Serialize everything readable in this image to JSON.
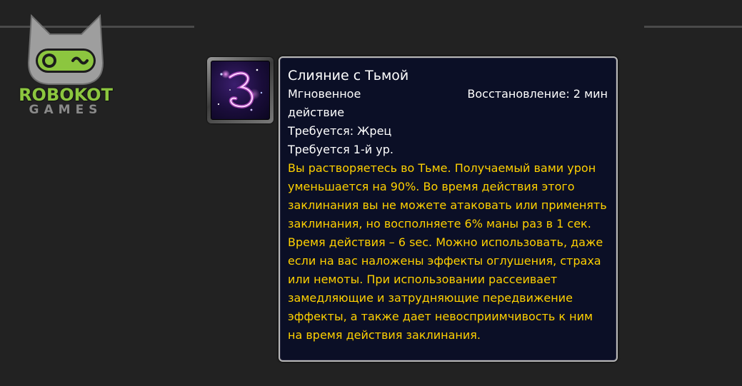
{
  "logo": {
    "word1": "ROBOKOT",
    "word2": "GAMES",
    "colors": {
      "green": "#8cc63f",
      "gray": "#8a8a8a",
      "head": "#9e9e9e"
    },
    "icon": "robot-cat-head-icon"
  },
  "spell": {
    "icon": "shadow-swirl-icon",
    "title": "Слияние с Тьмой",
    "cast_type": "Мгновенное действие",
    "cooldown": "Восстановление: 2 мин",
    "requires_class": "Требуется: Жрец",
    "requires_level": "Требуется 1-й ур.",
    "description": "Вы растворяетесь во Тьме. Получаемый вами урон уменьшается на 90%. Во время действия этого заклинания вы не можете атаковать или применять заклинания, но восполняете 6% маны раз в 1 сек. Время действия – 6 sec. Можно использовать, даже если на вас наложены эффекты оглушения, страха или немоты. При использовании рассеивает замедляющие и затрудняющие передвижение эффекты, а также дает невосприимчивость к ним на время действия заклинания."
  },
  "colors": {
    "background": "#222222",
    "tooltip_bg": "#0b0f26",
    "tooltip_border": "#b9b9b9",
    "description": "#ffd100",
    "text": "#ffffff"
  }
}
